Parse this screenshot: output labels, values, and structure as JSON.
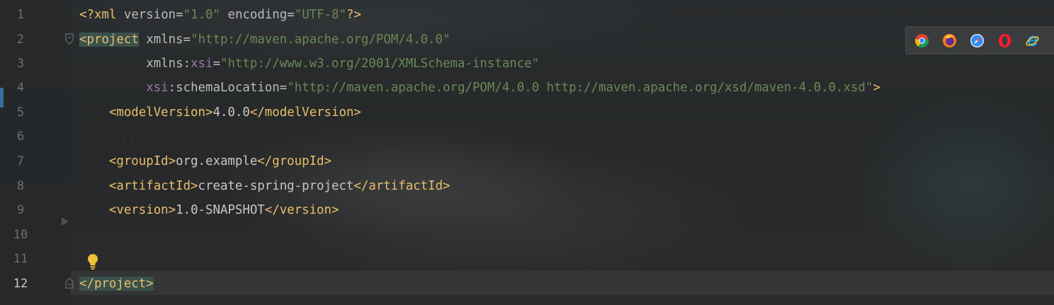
{
  "gutter": {
    "line_numbers": [
      "1",
      "2",
      "3",
      "4",
      "5",
      "6",
      "7",
      "8",
      "9",
      "10",
      "11",
      "12"
    ],
    "active_line": "12"
  },
  "code": {
    "l1": {
      "pi_open": "<?xml",
      "version_attr": "version",
      "version_eq": "=",
      "version_val": "\"1.0\"",
      "encoding_attr": "encoding",
      "encoding_eq": "=",
      "encoding_val": "\"UTF-8\"",
      "pi_close": "?>"
    },
    "l2": {
      "tag_open": "<project",
      "xmlns_attr": "xmlns",
      "eq": "=",
      "xmlns_val": "\"http://maven.apache.org/POM/4.0.0\""
    },
    "l3": {
      "prefix": "xmlns:",
      "ns": "xsi",
      "eq": "=",
      "val": "\"http://www.w3.org/2001/XMLSchema-instance\""
    },
    "l4": {
      "ns": "xsi",
      "attr": ":schemaLocation",
      "eq": "=",
      "val": "\"http://maven.apache.org/POM/4.0.0 http://maven.apache.org/xsd/maven-4.0.0.xsd\"",
      "close": ">"
    },
    "l5": {
      "open": "<modelVersion>",
      "text": "4.0.0",
      "close": "</modelVersion>"
    },
    "l7": {
      "open": "<groupId>",
      "text": "org.example",
      "close": "</groupId>"
    },
    "l8": {
      "open": "<artifactId>",
      "text": "create-spring-project",
      "close": "</artifactId>"
    },
    "l9": {
      "open": "<version>",
      "text": "1.0-SNAPSHOT",
      "close": "</version>"
    },
    "l12": {
      "close": "</project>"
    }
  },
  "browsers": [
    "chrome-icon",
    "firefox-icon",
    "safari-icon",
    "opera-icon",
    "internet-explorer-icon"
  ],
  "colors": {
    "tag": "#e8bf6a",
    "attribute": "#bababa",
    "namespace": "#9876aa",
    "string": "#6a8759",
    "line_number": "#6e7073",
    "background": "#2b2b2b"
  }
}
